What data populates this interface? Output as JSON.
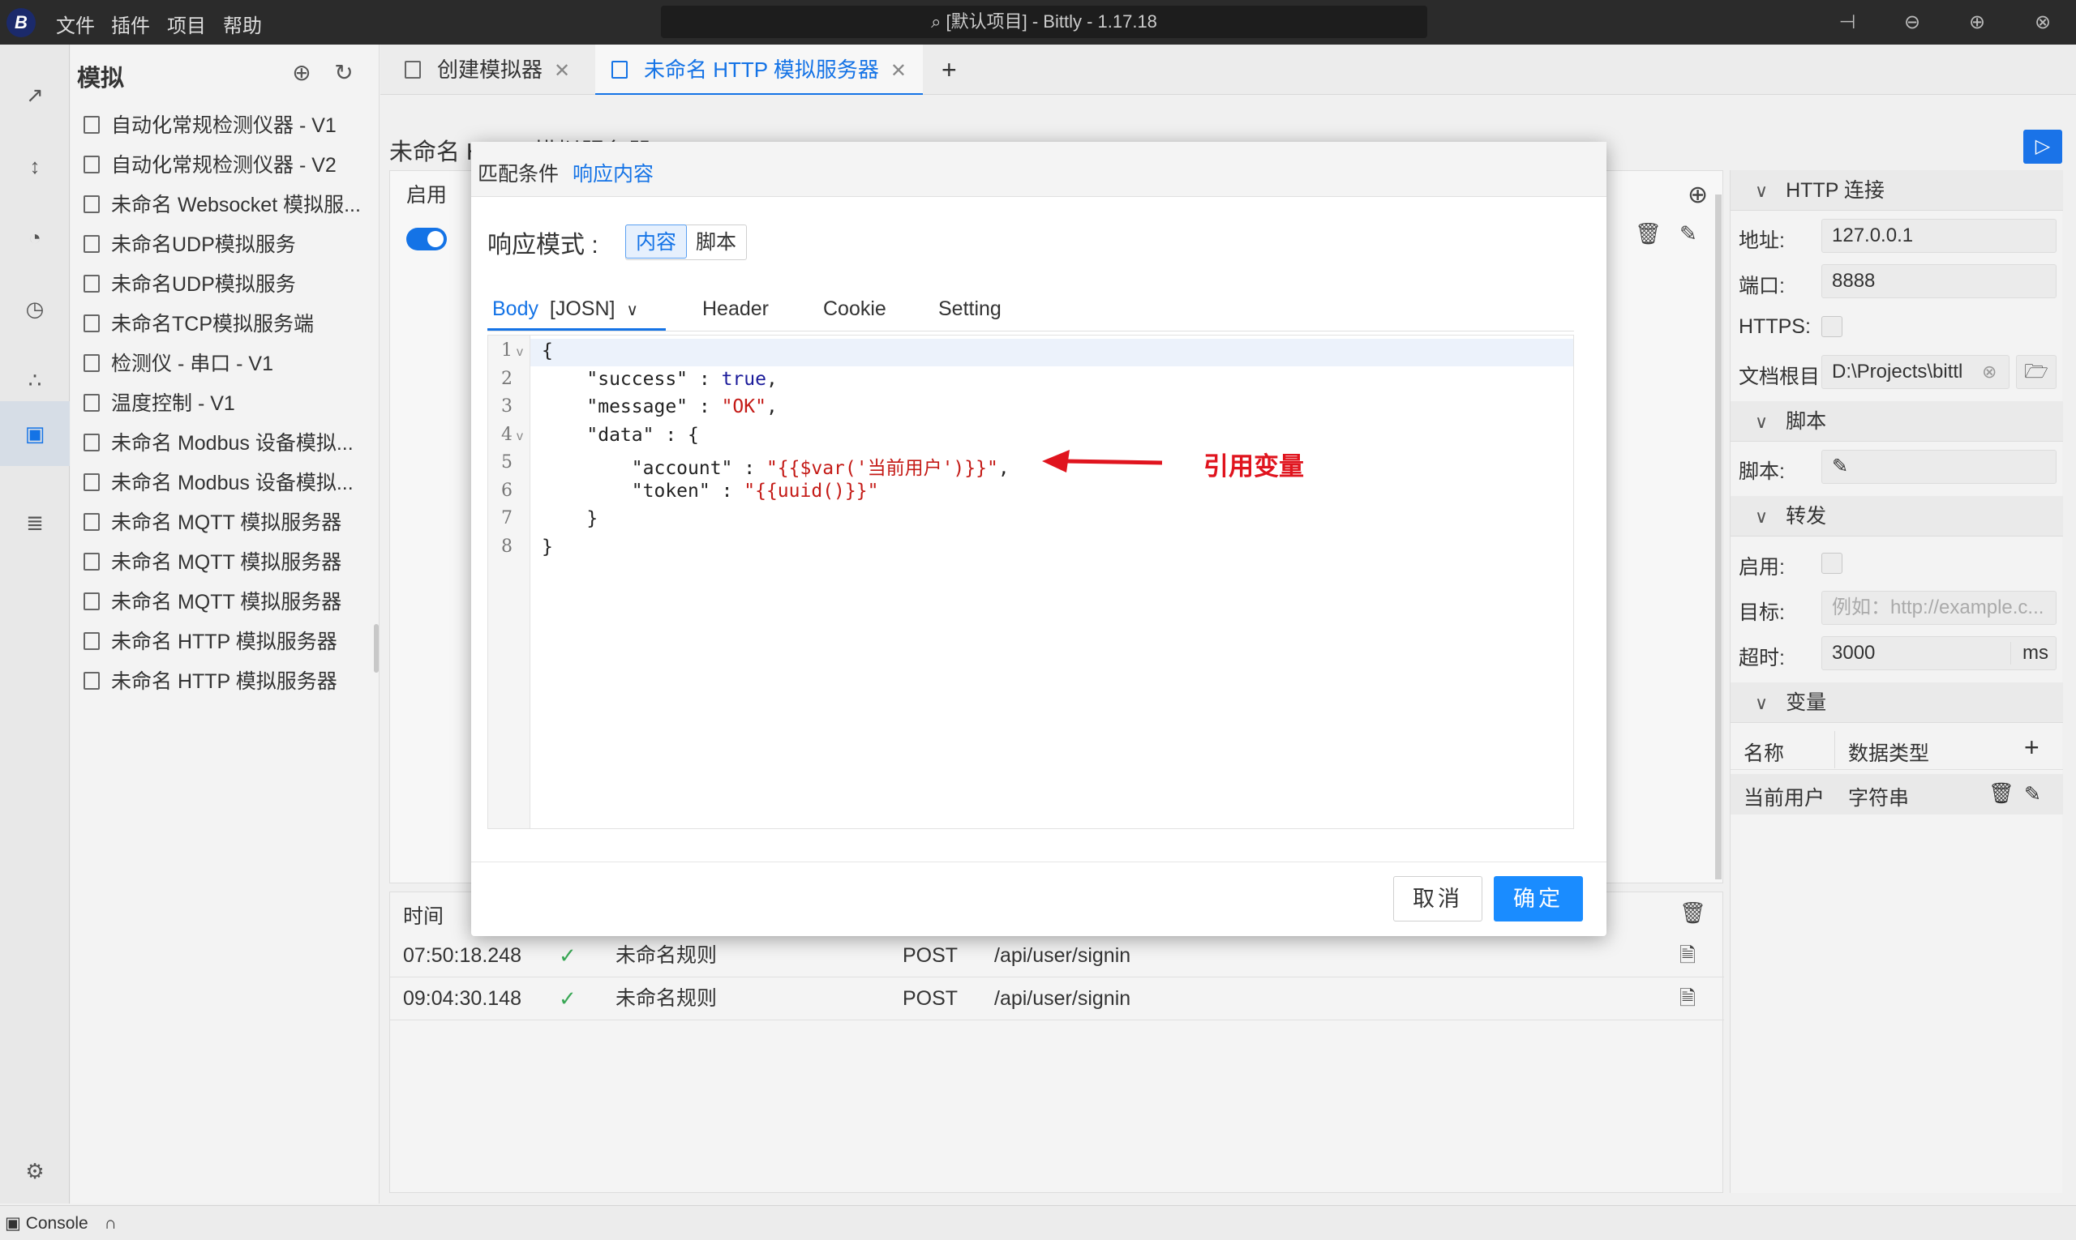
{
  "titlebar": {
    "logo": "B",
    "menus": [
      "文件",
      "插件",
      "项目",
      "帮助"
    ],
    "title": "[默认项目] - Bittly - 1.17.18",
    "icons": [
      "search-icon",
      "pin-icon",
      "minimize-icon",
      "maximize-icon",
      "close-icon"
    ]
  },
  "activitybar": {
    "icons": [
      "rocket-icon",
      "ruler-icon",
      "gauge-icon",
      "timer-icon",
      "share-nodes-icon",
      "simulator-icon",
      "scan-icon",
      "settings-icon"
    ]
  },
  "sidebar": {
    "title": "模拟",
    "items": [
      "自动化常规检测仪器 - V1",
      "自动化常规检测仪器 - V2",
      "未命名 Websocket 模拟服...",
      "未命名UDP模拟服务",
      "未命名UDP模拟服务",
      "未命名TCP模拟服务端",
      "检测仪 - 串口 - V1",
      "温度控制 - V1",
      "未命名 Modbus 设备模拟...",
      "未命名 Modbus 设备模拟...",
      "未命名 MQTT 模拟服务器",
      "未命名 MQTT 模拟服务器",
      "未命名 MQTT 模拟服务器",
      "未命名 HTTP 模拟服务器",
      "未命名 HTTP 模拟服务器"
    ]
  },
  "tabs": [
    {
      "label": "创建模拟器",
      "active": false
    },
    {
      "label": "未命名 HTTP 模拟服务器",
      "active": true
    }
  ],
  "main": {
    "heading": "未命名 HTTP 模拟服务器",
    "rules_header_enable": "启用",
    "log": {
      "col_time": "时间",
      "rows": [
        {
          "time": "07:50:18.248",
          "rule": "未命名规则",
          "method": "POST",
          "path": "/api/user/signin"
        },
        {
          "time": "09:04:30.148",
          "rule": "未命名规则",
          "method": "POST",
          "path": "/api/user/signin"
        }
      ]
    }
  },
  "props": {
    "http_section": "HTTP 连接",
    "address_label": "地址:",
    "address_value": "127.0.0.1",
    "port_label": "端口:",
    "port_value": "8888",
    "https_label": "HTTPS:",
    "docroot_label": "文档根目",
    "docroot_value": "D:\\Projects\\bittl",
    "script_section": "脚本",
    "script_label": "脚本:",
    "forward_section": "转发",
    "forward_enable_label": "启用:",
    "target_label": "目标:",
    "target_placeholder": "例如：http://example.c...",
    "timeout_label": "超时:",
    "timeout_value": "3000",
    "timeout_unit": "ms",
    "vars_section": "变量",
    "vars_col_name": "名称",
    "vars_col_type": "数据类型",
    "vars_rows": [
      {
        "name": "当前用户",
        "type": "字符串"
      }
    ]
  },
  "statusbar": {
    "console": "Console"
  },
  "modal": {
    "tabs": [
      "匹配条件",
      "响应内容"
    ],
    "active_tab": "响应内容",
    "mode_label": "响应模式 :",
    "mode_options": [
      "内容",
      "脚本"
    ],
    "mode_selected": "内容",
    "body_tab": "Body",
    "body_format": "[JOSN]",
    "other_tabs": [
      "Header",
      "Cookie",
      "Setting"
    ],
    "code_lines": [
      "{",
      "    \"success\" : true,",
      "    \"message\" : \"OK\",",
      "    \"data\" : {",
      "        \"account\" : \"{{$var('当前用户')}}\",",
      "        \"token\" : \"{{uuid()}}\"",
      "    }",
      "}"
    ],
    "cancel": "取消",
    "ok": "确定"
  },
  "annotation": {
    "text": "引用变量",
    "color": "#e0141e"
  },
  "colors": {
    "accent": "#1473e6",
    "primary_button": "#1a8cff",
    "titlebar": "#2b2b2b"
  }
}
